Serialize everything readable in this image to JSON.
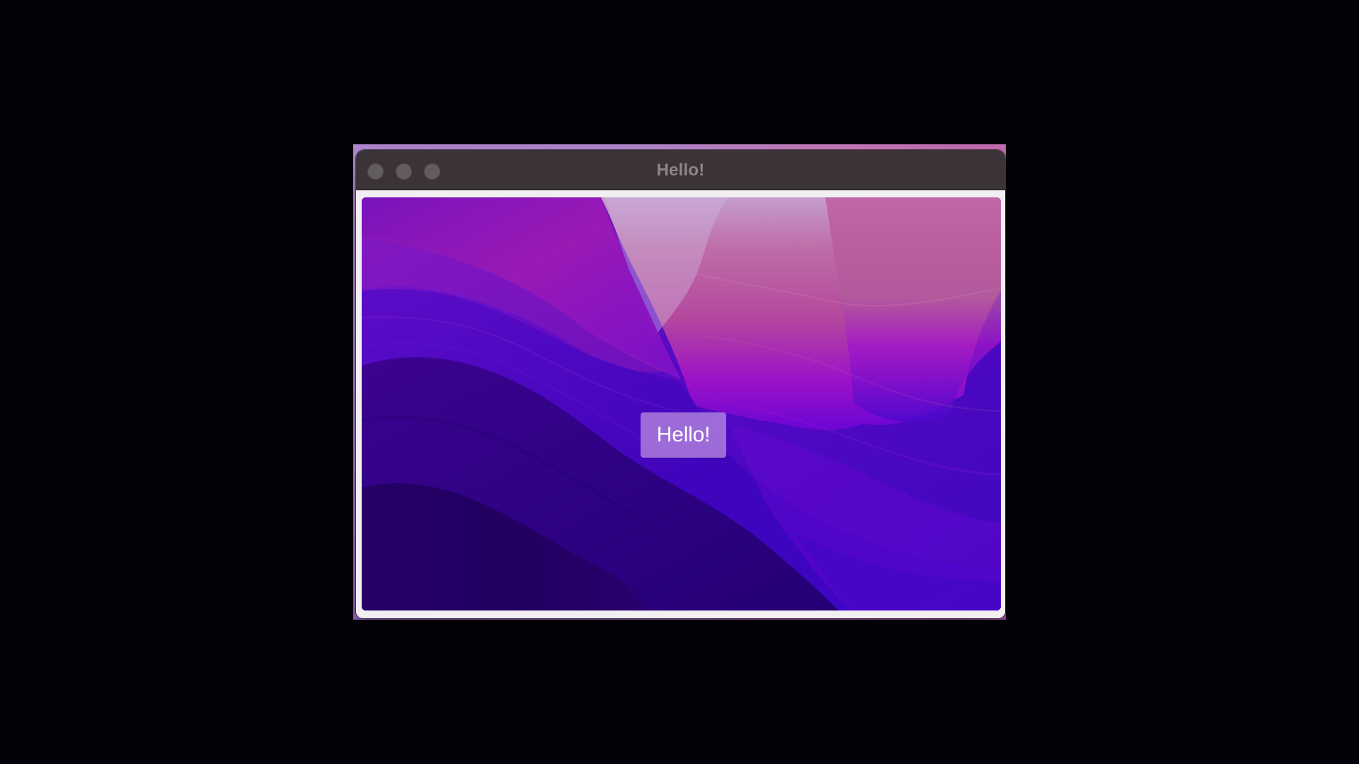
{
  "window": {
    "title": "Hello!"
  },
  "content": {
    "button_label": "Hello!"
  },
  "icons": {
    "close": "traffic-close-icon",
    "minimize": "traffic-minimize-icon",
    "zoom": "traffic-zoom-icon"
  },
  "colors": {
    "desktop_background": "#030208",
    "titlebar": "#3b3337",
    "title_text": "#8d8589",
    "traffic_light": "#625b60",
    "button_background": "#a97adb",
    "button_text": "#ffffff"
  }
}
